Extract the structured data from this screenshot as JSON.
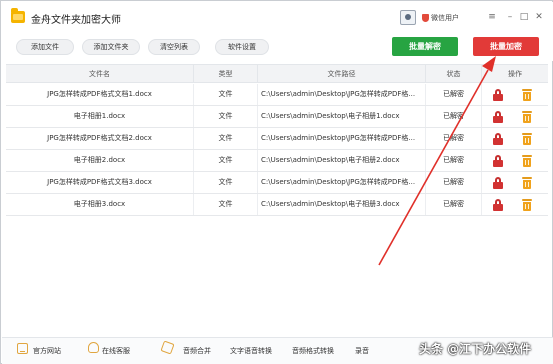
{
  "window": {
    "title": "金舟文件夹加密大师",
    "user_label": "微信用户",
    "controls": {
      "menu": "≡",
      "minimize": "–",
      "maximize": "□",
      "close": "✕"
    }
  },
  "toolbar": {
    "add_file": "添加文件",
    "add_folder": "添加文件夹",
    "clear_list": "清空列表",
    "settings": "软件设置",
    "batch_decrypt": "批量解密",
    "batch_encrypt": "批量加密"
  },
  "table": {
    "headers": {
      "name": "文件名",
      "type": "类型",
      "path": "文件路径",
      "status": "状态",
      "ops": "操作"
    },
    "rows": [
      {
        "name": "JPG怎样转成PDF格式文档1.docx",
        "type": "文件",
        "path": "C:\\Users\\admin\\Desktop\\JPG怎样转成PDF格...",
        "status": "已解密"
      },
      {
        "name": "电子相册1.docx",
        "type": "文件",
        "path": "C:\\Users\\admin\\Desktop\\电子相册1.docx",
        "status": "已解密"
      },
      {
        "name": "JPG怎样转成PDF格式文档2.docx",
        "type": "文件",
        "path": "C:\\Users\\admin\\Desktop\\JPG怎样转成PDF格...",
        "status": "已解密"
      },
      {
        "name": "电子相册2.docx",
        "type": "文件",
        "path": "C:\\Users\\admin\\Desktop\\电子相册2.docx",
        "status": "已解密"
      },
      {
        "name": "JPG怎样转成PDF格式文档3.docx",
        "type": "文件",
        "path": "C:\\Users\\admin\\Desktop\\JPG怎样转成PDF格...",
        "status": "已解密"
      },
      {
        "name": "电子相册3.docx",
        "type": "文件",
        "path": "C:\\Users\\admin\\Desktop\\电子相册3.docx",
        "status": "已解密"
      }
    ]
  },
  "footer": {
    "official_site": "官方网站",
    "online_service": "在线客服",
    "audio_merge": "音频合并",
    "text_to_speech": "文字语音转换",
    "audio_format": "音频格式转换",
    "record": "录音"
  },
  "watermark": "头条 @江下办公软件",
  "colors": {
    "decrypt_green": "#27a442",
    "encrypt_red": "#e23a38",
    "lock_red": "#d23232",
    "trash_orange": "#f0a21c",
    "arrow_red": "#e0302a"
  },
  "icons": {
    "app": "folder-icon",
    "avatar": "avatar-icon",
    "vip": "shield-icon",
    "row_encrypt": "lock-icon",
    "row_delete": "trash-icon"
  }
}
